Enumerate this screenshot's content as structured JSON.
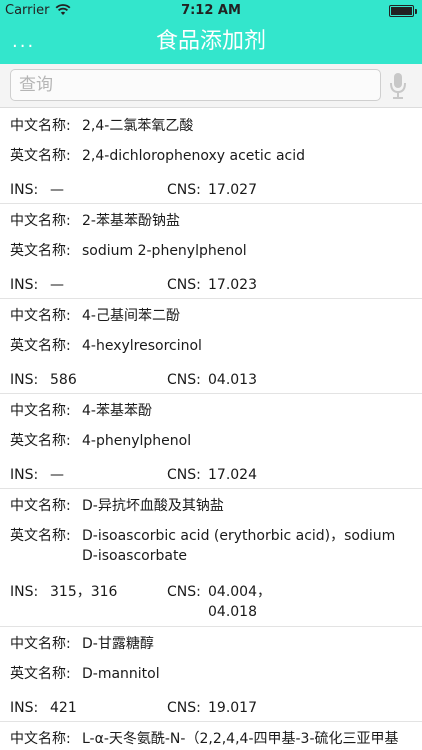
{
  "status_bar": {
    "carrier": "Carrier",
    "time": "7:12 AM"
  },
  "nav": {
    "menu": "...",
    "title": "食品添加剂"
  },
  "search": {
    "placeholder": "查询",
    "value": ""
  },
  "labels": {
    "cn_name": "中文名称:",
    "en_name": "英文名称:",
    "ins": "INS:",
    "cns": "CNS:"
  },
  "items": [
    {
      "cn": "2,4-二氯苯氧乙酸",
      "en": "2,4-dichlorophenoxy acetic acid",
      "ins": "—",
      "cns": "17.027"
    },
    {
      "cn": "2-苯基苯酚钠盐",
      "en": "sodium 2-phenylphenol",
      "ins": "—",
      "cns": "17.023"
    },
    {
      "cn": "4-己基间苯二酚",
      "en": "4-hexylresorcinol",
      "ins": "586",
      "cns": "04.013"
    },
    {
      "cn": "4-苯基苯酚",
      "en": "4-phenylphenol",
      "ins": "—",
      "cns": "17.024"
    },
    {
      "cn": "D-异抗坏血酸及其钠盐",
      "en": "D-isoascorbic acid (erythorbic acid)，sodium D-isoascorbate",
      "ins": "315，316",
      "cns": "04.004，04.018"
    },
    {
      "cn": "D-甘露糖醇",
      "en": "D-mannitol",
      "ins": "421",
      "cns": "19.017"
    },
    {
      "cn": "L-α-天冬氨酰-N-（2,2,4,4-四甲基-3-硫化三亚甲基"
    }
  ],
  "colors": {
    "header": "#33e6cc",
    "header_text": "#ffffff"
  }
}
